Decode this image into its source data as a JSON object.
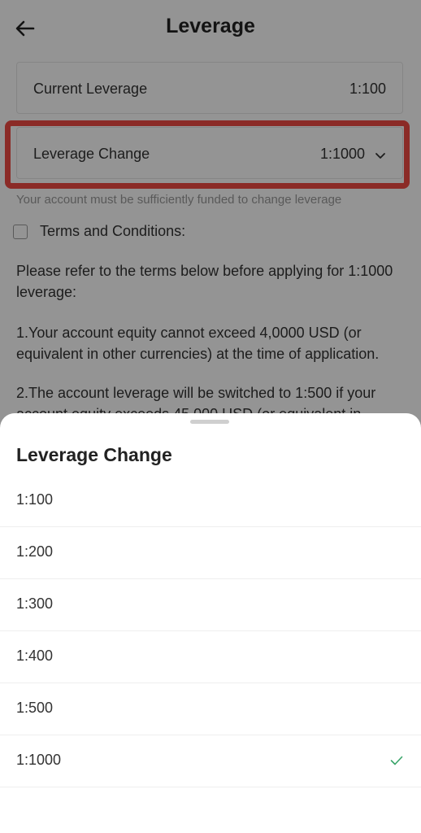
{
  "header": {
    "title": "Leverage",
    "back_icon": "back-arrow-icon"
  },
  "current_leverage": {
    "label": "Current Leverage",
    "value": "1:100"
  },
  "leverage_change": {
    "label": "Leverage Change",
    "value": "1:1000",
    "icon": "chevron-down-icon"
  },
  "highlight_color": "#f04a44",
  "note": "Your account must be sufficiently funded to change leverage",
  "terms": {
    "label": "Terms and Conditions:",
    "intro": "Please refer to the terms below before applying for 1:1000 leverage:",
    "item1": "1.Your account equity cannot exceed 4,0000 USD (or equivalent in other currencies) at the time of application.",
    "item2": "2.The account leverage will be switched to 1:500 if your account equity exceeds 45,000 USD (or equivalent in"
  },
  "sheet": {
    "title": "Leverage Change",
    "options": [
      "1:100",
      "1:200",
      "1:300",
      "1:400",
      "1:500",
      "1:1000"
    ],
    "selected": "1:1000",
    "check_color": "#3aa56a"
  }
}
